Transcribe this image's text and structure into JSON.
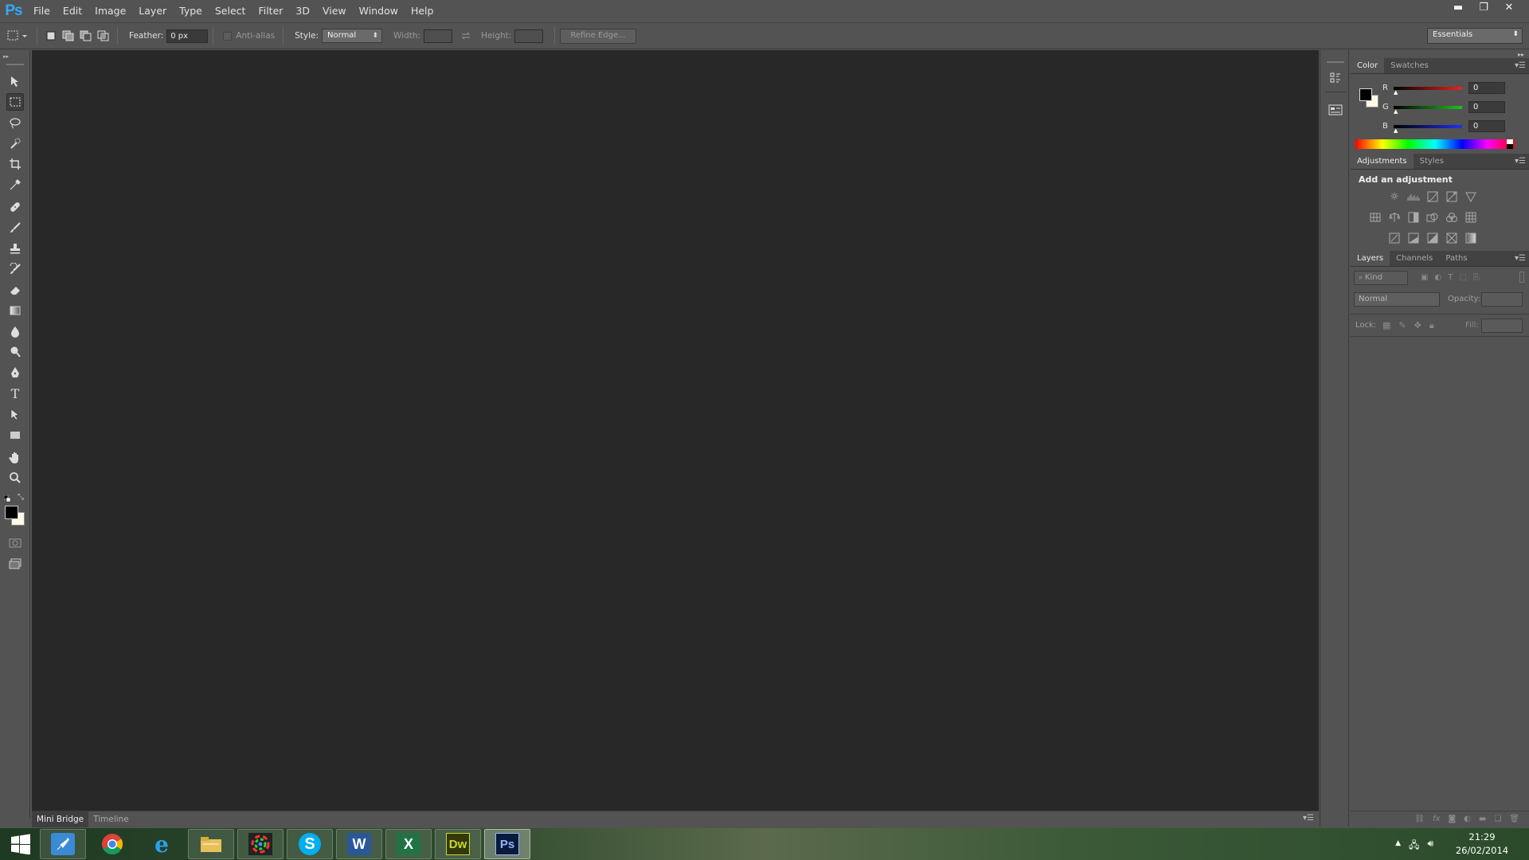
{
  "app": {
    "logo_text": "Ps"
  },
  "menu": [
    "File",
    "Edit",
    "Image",
    "Layer",
    "Type",
    "Select",
    "Filter",
    "3D",
    "View",
    "Window",
    "Help"
  ],
  "window_controls": {
    "minimize": "▬",
    "restore": "❐",
    "close": "✕"
  },
  "options_bar": {
    "feather_label": "Feather:",
    "feather_value": "0 px",
    "antialias_label": "Anti-alias",
    "style_label": "Style:",
    "style_value": "Normal",
    "width_label": "Width:",
    "height_label": "Height:",
    "refine_edge_label": "Refine Edge...",
    "workspace_value": "Essentials"
  },
  "bottom_tabs": [
    "Mini Bridge",
    "Timeline"
  ],
  "color_panel": {
    "tabs": [
      "Color",
      "Swatches"
    ],
    "channels": [
      {
        "label": "R",
        "value": "0",
        "color": "#e02020"
      },
      {
        "label": "G",
        "value": "0",
        "color": "#20b020"
      },
      {
        "label": "B",
        "value": "0",
        "color": "#2030e0"
      }
    ],
    "foreground": "#000000",
    "background": "#fffbe6"
  },
  "adjustments_panel": {
    "tabs": [
      "Adjustments",
      "Styles"
    ],
    "title": "Add an adjustment"
  },
  "layers_panel": {
    "tabs": [
      "Layers",
      "Channels",
      "Paths"
    ],
    "kind_label": "Kind",
    "blend_mode": "Normal",
    "opacity_label": "Opacity:",
    "lock_label": "Lock:",
    "fill_label": "Fill:"
  },
  "taskbar": {
    "apps": [
      "Rocket",
      "Chrome",
      "Internet Explorer",
      "File Explorer",
      "Color Picker",
      "Skype",
      "Word",
      "Excel",
      "Dreamweaver",
      "Photoshop"
    ],
    "skype_letter": "S",
    "word_letter": "W",
    "excel_letter": "X",
    "dw_letters": "Dw",
    "ps_letters": "Ps",
    "time": "21:29",
    "date": "26/02/2014"
  }
}
